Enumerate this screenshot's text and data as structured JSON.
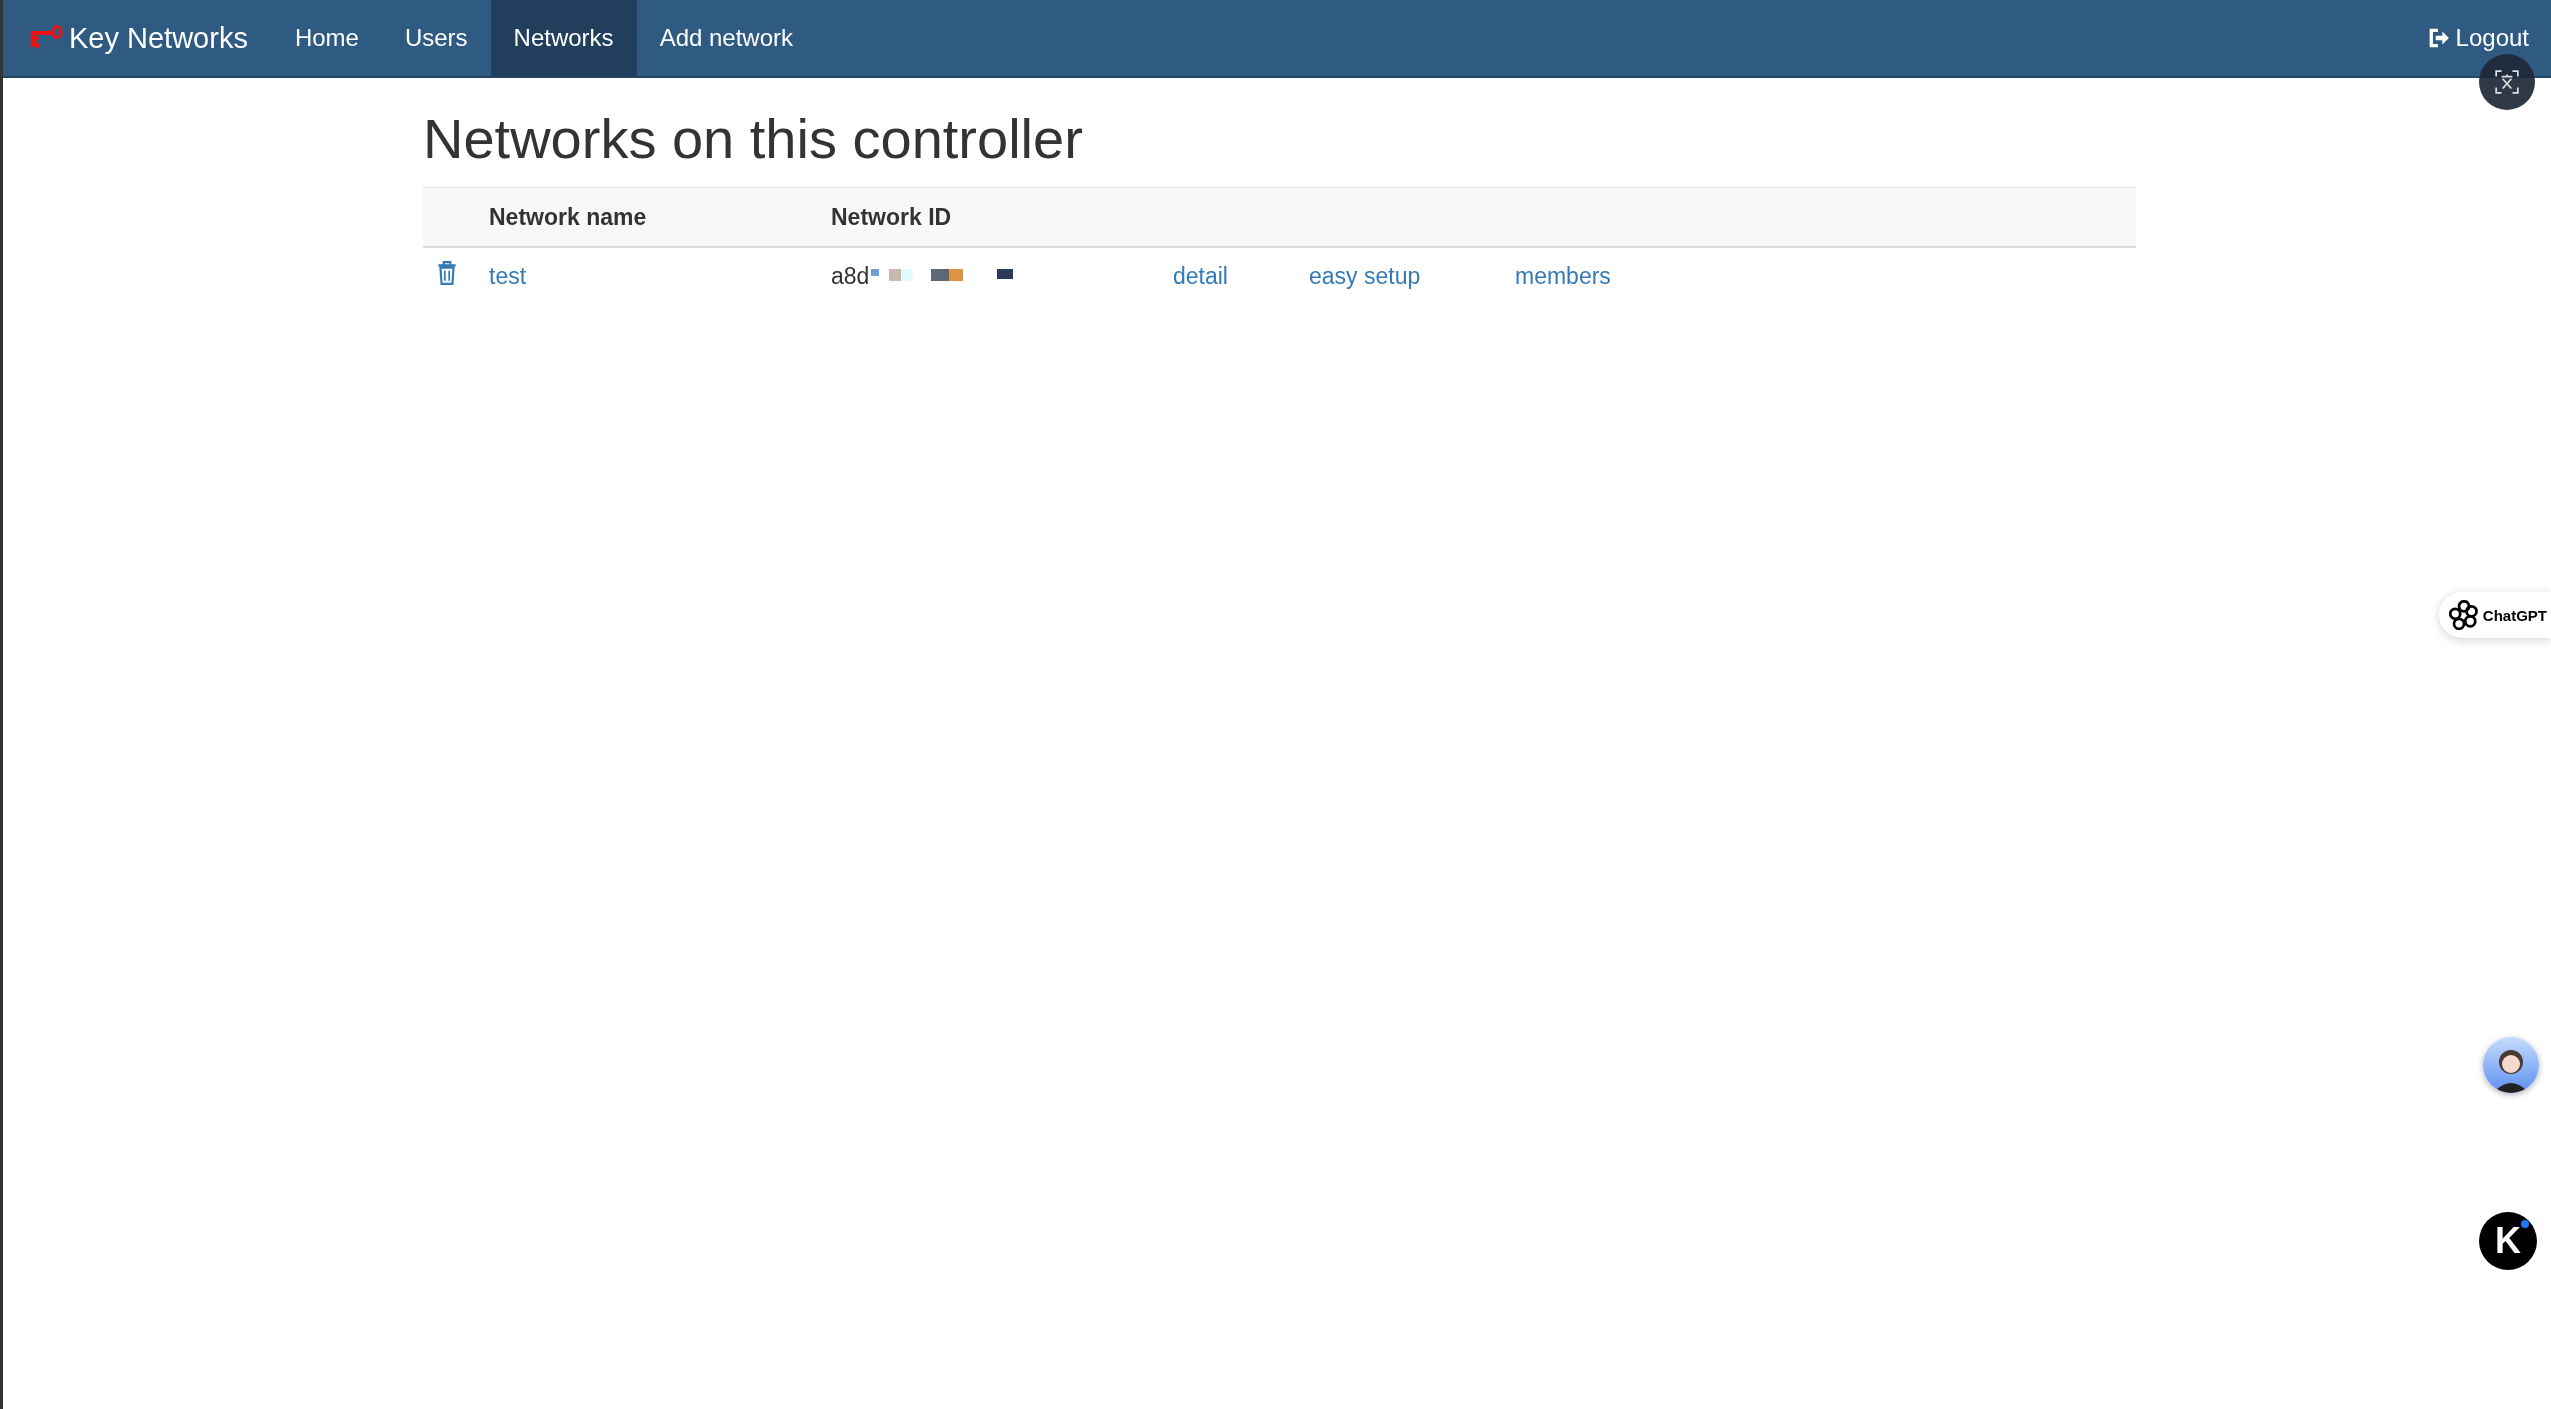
{
  "navbar": {
    "brand": "Key Networks",
    "items": [
      {
        "label": "Home",
        "selected": false
      },
      {
        "label": "Users",
        "selected": false
      },
      {
        "label": "Networks",
        "selected": true
      },
      {
        "label": "Add network",
        "selected": false
      }
    ],
    "logout": "Logout"
  },
  "page": {
    "title": "Networks on this controller"
  },
  "table": {
    "columns": [
      "Network name",
      "Network ID"
    ],
    "rows": [
      {
        "name": "test",
        "network_id": "a8d",
        "links": [
          "detail",
          "easy setup",
          "members"
        ]
      }
    ]
  },
  "floating": {
    "chatgpt": "ChatGPT",
    "k_button": "K"
  }
}
